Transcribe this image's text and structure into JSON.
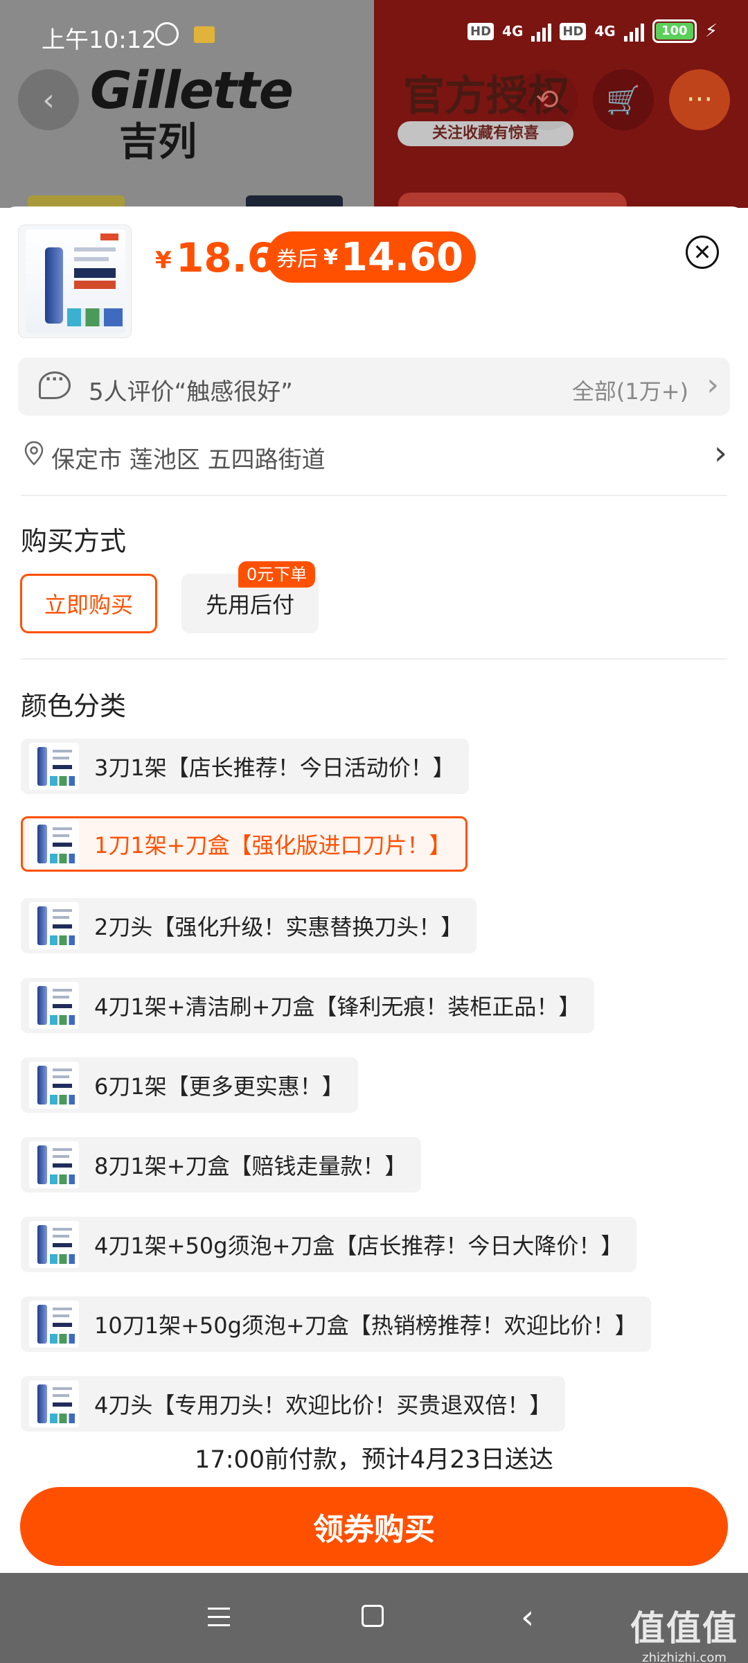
{
  "status_bar": {
    "time": "上午10:12",
    "hd1": "HD",
    "net1": "4G",
    "hd2": "HD",
    "net2": "4G",
    "battery": "100"
  },
  "background": {
    "brand_en": "Gillette",
    "brand_cn": "吉列",
    "promo_main": "官方授权",
    "promo_sub": "关注收藏有惊喜"
  },
  "product": {
    "price_symbol": "¥",
    "price": "18.6",
    "coupon_label": "券后",
    "coupon_symbol": "¥",
    "coupon_price": "14.60"
  },
  "review": {
    "text": "5人评价“触感很好”",
    "all": "全部(1万+)"
  },
  "address": {
    "text": "保定市 莲池区 五四路街道"
  },
  "purchase": {
    "title": "购买方式",
    "options": [
      "立即购买",
      "先用后付"
    ],
    "badge": "0元下单"
  },
  "colors": {
    "title": "颜色分类",
    "items": [
      "3刀1架【店长推荐！今日活动价！】",
      "1刀1架+刀盒【强化版进口刀片！】",
      "2刀头【强化升级！实惠替换刀头！】",
      "4刀1架+清洁刷+刀盒【锋利无痕！装柜正品！】",
      "6刀1架【更多更实惠！】",
      "8刀1架+刀盒【赔钱走量款！】",
      "4刀1架+50g须泡+刀盒【店长推荐！今日大降价！】",
      "10刀1架+50g须泡+刀盒【热销榜推荐！欢迎比价！】",
      "4刀头【专用刀头！欢迎比价！买贵退双倍！】"
    ],
    "selected_index": 1
  },
  "delivery": "17:00前付款，预计4月23日送达",
  "cta": "领券购买",
  "watermark": {
    "main": "值值值",
    "sub": "zhizhizhi.com"
  },
  "accent_color": "#ff5000",
  "icons": [
    "back-arrow-icon",
    "share-icon",
    "cart-icon",
    "more-icon",
    "close-icon",
    "chat-icon",
    "location-pin-icon",
    "chevron-right-icon",
    "menu-icon",
    "home-icon",
    "nav-back-icon"
  ]
}
